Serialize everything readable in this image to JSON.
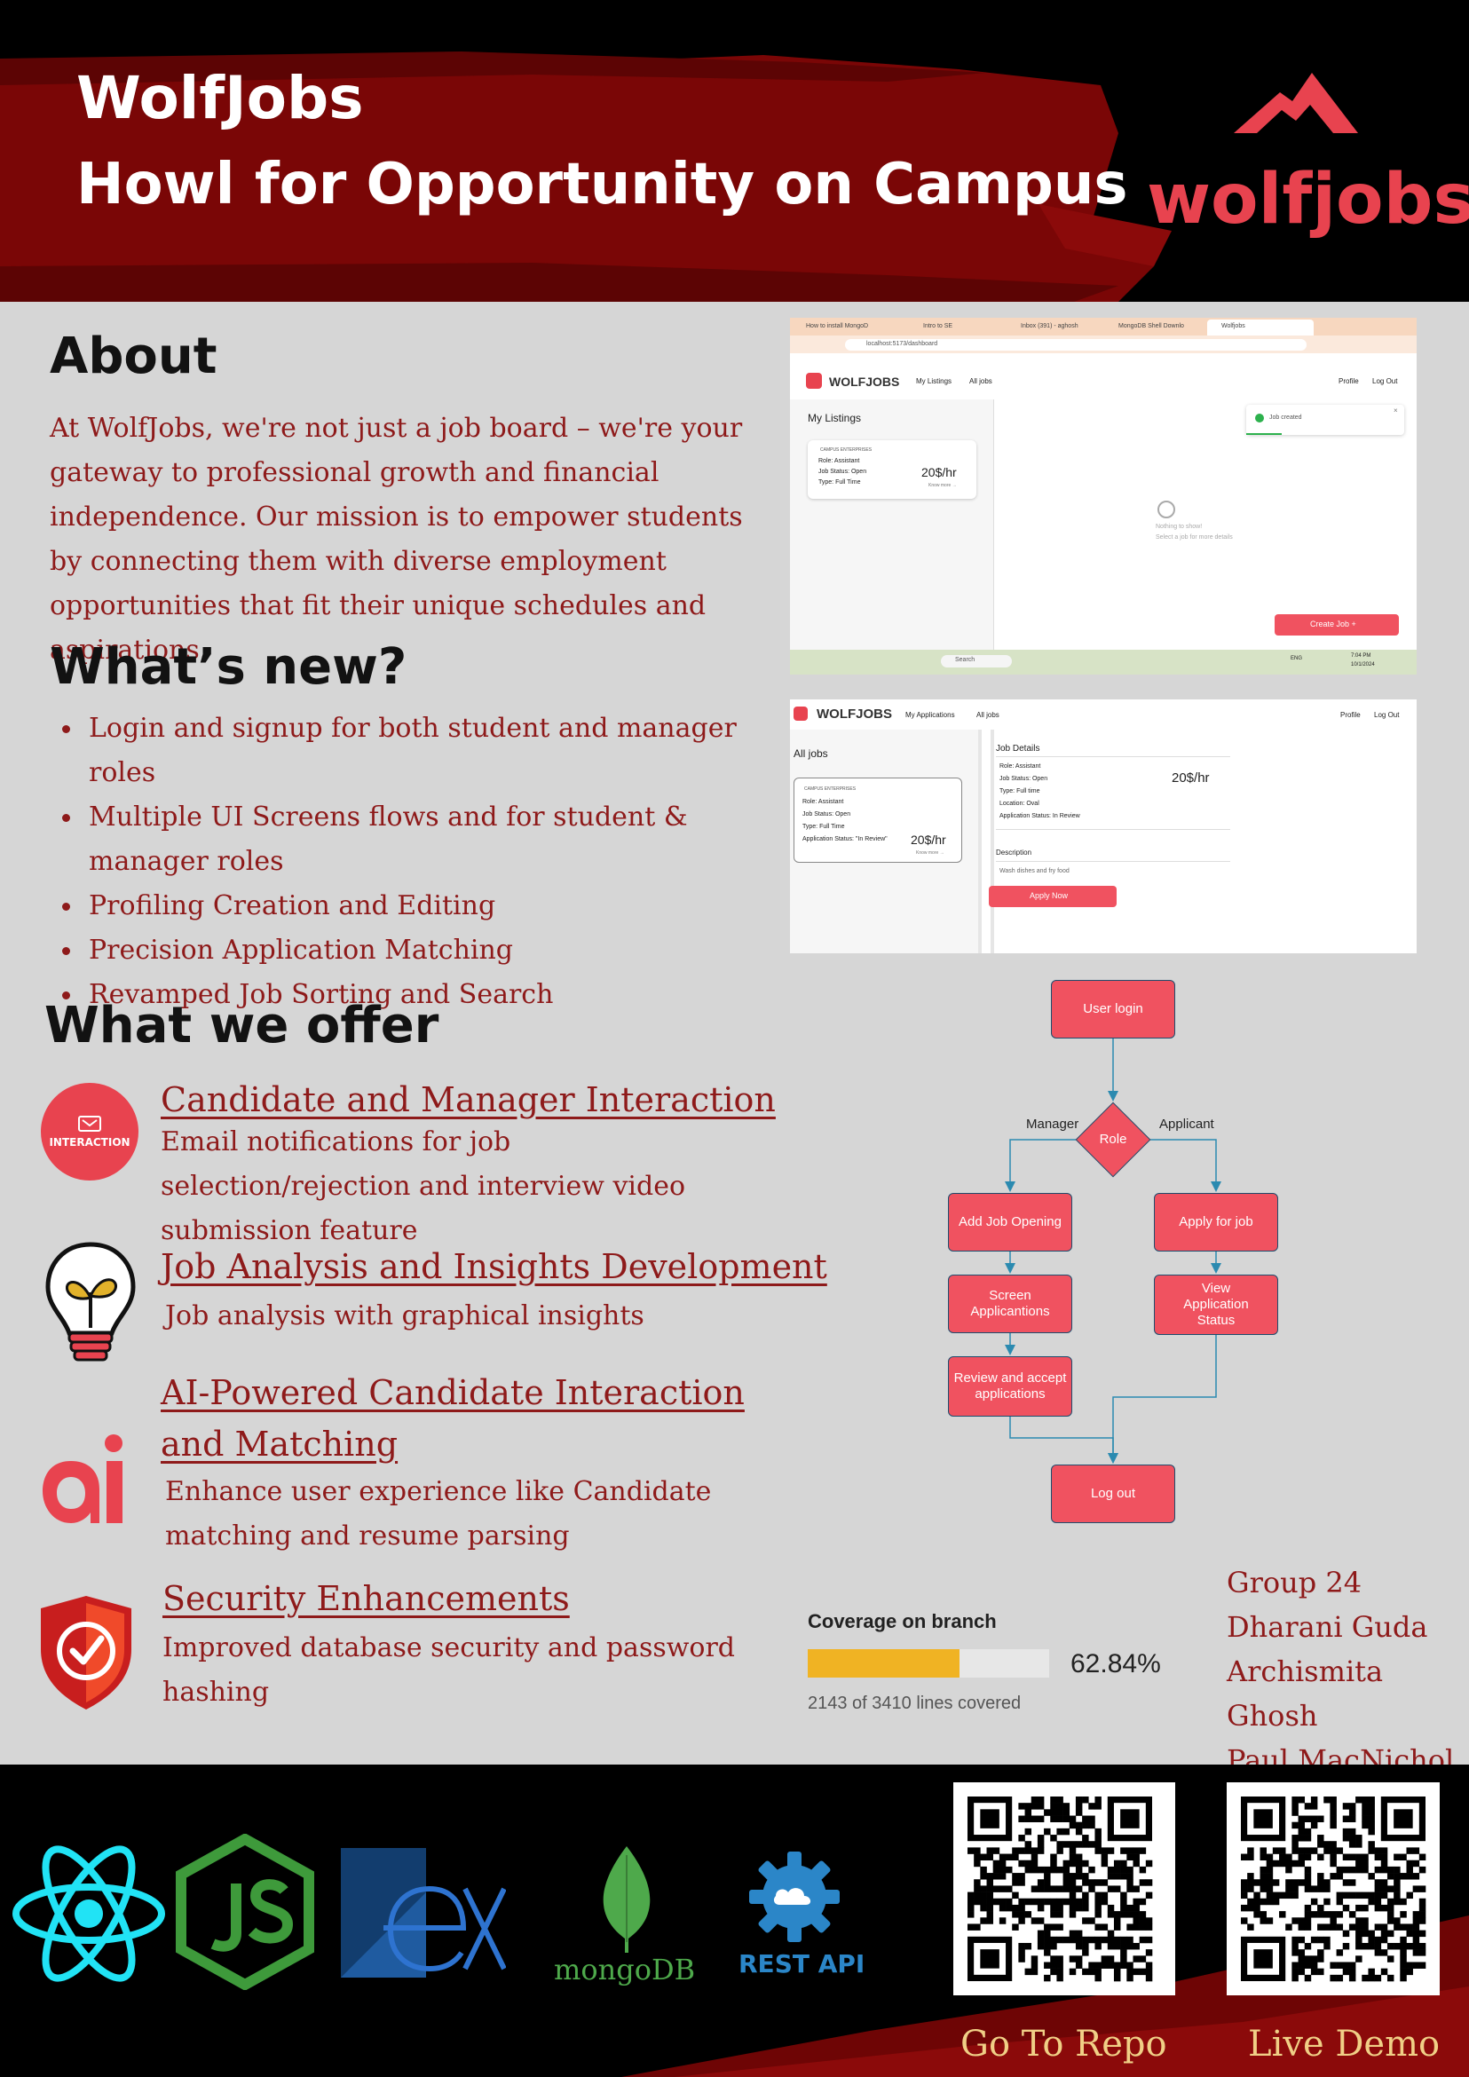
{
  "header": {
    "title": "WolfJobs",
    "subtitle": "Howl for Opportunity on Campus",
    "logo_text": "wolfjobs"
  },
  "about": {
    "heading": "About",
    "text": "At WolfJobs, we're not just a job board – we're your gateway to professional growth and financial independence. Our mission is to empower students by connecting them with diverse employment opportunities that fit their unique schedules and aspirations."
  },
  "whats_new": {
    "heading": "What’s new?",
    "items": [
      "Login and signup for both student and manager roles",
      "Multiple UI Screens flows and for student & manager roles",
      "Profiling Creation and Editing",
      "Precision Application Matching",
      "Revamped Job Sorting and Search"
    ]
  },
  "offer": {
    "heading": "What we offer",
    "items": [
      {
        "title": "Candidate and Manager Interaction",
        "desc": "Email notifications for job selection/rejection and interview video submission feature",
        "icon_label": "INTERACTION"
      },
      {
        "title": "Job Analysis and Insights Development",
        "desc": "Job analysis with graphical insights"
      },
      {
        "title": "AI-Powered Candidate Interaction and Matching",
        "desc": "Enhance user experience  like Candidate matching and resume parsing"
      },
      {
        "title": "Security Enhancements",
        "desc": "Improved database security and password hashing"
      }
    ]
  },
  "screenshot_manager": {
    "tabs": [
      "How to install MongoD",
      "Intro to SE",
      "Inbox (391) - aghosh",
      "MongoDB Shell Downlo",
      "Wolfjobs"
    ],
    "url": "localhost:5173/dashboard",
    "brand": "WOLFJOBS",
    "nav": [
      "My Listings",
      "All jobs"
    ],
    "nav_right": [
      "Profile",
      "Log Out"
    ],
    "panel_title": "My Listings",
    "card_tag": "CAMPUS ENTERPRISES",
    "card_role": "Role: Assistant",
    "card_status": "Job Status: Open",
    "card_type": "Type: Full Time",
    "card_pay": "20$/hr",
    "card_more": "Know more →",
    "toast": "Job created",
    "empty_title": "Nothing to show!",
    "empty_sub": "Select a job for more details",
    "create_btn": "Create Job +",
    "taskbar_search": "Search",
    "taskbar_time": "7:04 PM",
    "taskbar_date": "10/1/2024",
    "taskbar_lang": "ENG"
  },
  "screenshot_applicant": {
    "brand": "WOLFJOBS",
    "nav": [
      "My Applications",
      "All jobs"
    ],
    "nav_right": [
      "Profile",
      "Log Out"
    ],
    "panel_title": "All jobs",
    "card_tag": "CAMPUS ENTERPRISES",
    "card_role": "Role: Assistant",
    "card_status": "Job Status: Open",
    "card_type": "Type: Full Time",
    "card_app_status": "Application Status: \"In Review\"",
    "card_pay": "20$/hr",
    "card_more": "Know more →",
    "details_title": "Job Details",
    "detail_role": "Role: Assistant",
    "detail_status": "Job Status: Open",
    "detail_type": "Type: Full time",
    "detail_location": "Location: Oval",
    "detail_app_status": "Application Status: In Review",
    "detail_pay": "20$/hr",
    "desc_title": "Description",
    "desc_text": "Wash dishes and fry food",
    "apply_btn": "Apply Now"
  },
  "flowchart": {
    "nodes": {
      "login": "User login",
      "role": "Role",
      "add_job": "Add Job Opening",
      "screen": "Screen Applicantions",
      "review": "Review and accept applications",
      "apply": "Apply for job",
      "view": "View Application Status",
      "logout": "Log out"
    },
    "labels": {
      "manager": "Manager",
      "applicant": "Applicant"
    }
  },
  "coverage": {
    "title": "Coverage on branch",
    "percent_text": "62.84%",
    "percent": 62.84,
    "lines": "2143 of 3410 lines covered"
  },
  "team": {
    "group": "Group 24",
    "members": [
      "Dharani Guda",
      "Archismita Ghosh",
      "Paul MacNichol"
    ]
  },
  "footer": {
    "mongo_label": "mongoDB",
    "rest_label": "REST API",
    "repo_caption": "Go To Repo",
    "demo_caption": "Live Demo"
  },
  "colors": {
    "brand_red": "#e8434f",
    "dark_red": "#8e1a1a",
    "brush_red": "#7a0606",
    "coverage_fill": "#f0b323"
  }
}
